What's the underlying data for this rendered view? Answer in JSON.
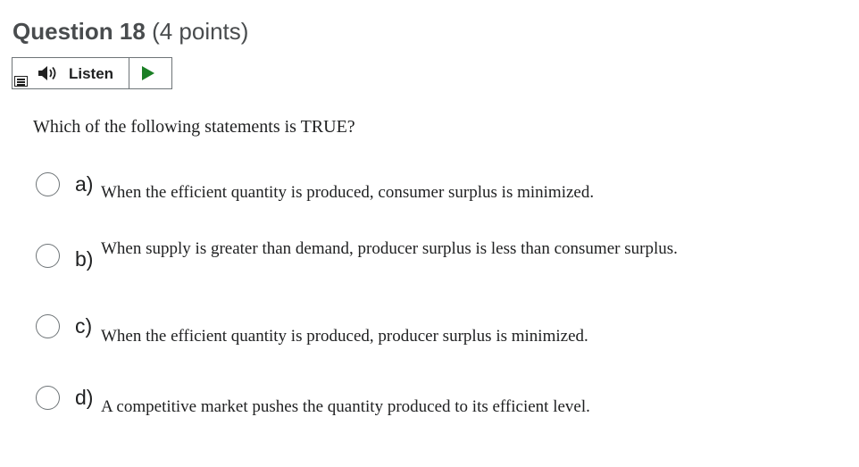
{
  "question": {
    "title": "Question 18",
    "points": "(4 points)",
    "prompt": "Which of the following statements is TRUE?"
  },
  "listen": {
    "menu_icon": "menu-icon",
    "speaker_icon": "speaker-icon",
    "label": "Listen",
    "play_icon": "play-icon",
    "play_color": "#1a7f25"
  },
  "options": [
    {
      "letter": "a)",
      "text": "When the efficient quantity is produced, consumer surplus is minimized.",
      "selected": false
    },
    {
      "letter": "b)",
      "text": "When supply is greater than demand, producer surplus is less than consumer surplus.",
      "selected": false
    },
    {
      "letter": "c)",
      "text": "When the efficient quantity is produced, producer surplus is minimized.",
      "selected": false
    },
    {
      "letter": "d)",
      "text": "A competitive market pushes the quantity produced to its efficient level.",
      "selected": false
    }
  ]
}
